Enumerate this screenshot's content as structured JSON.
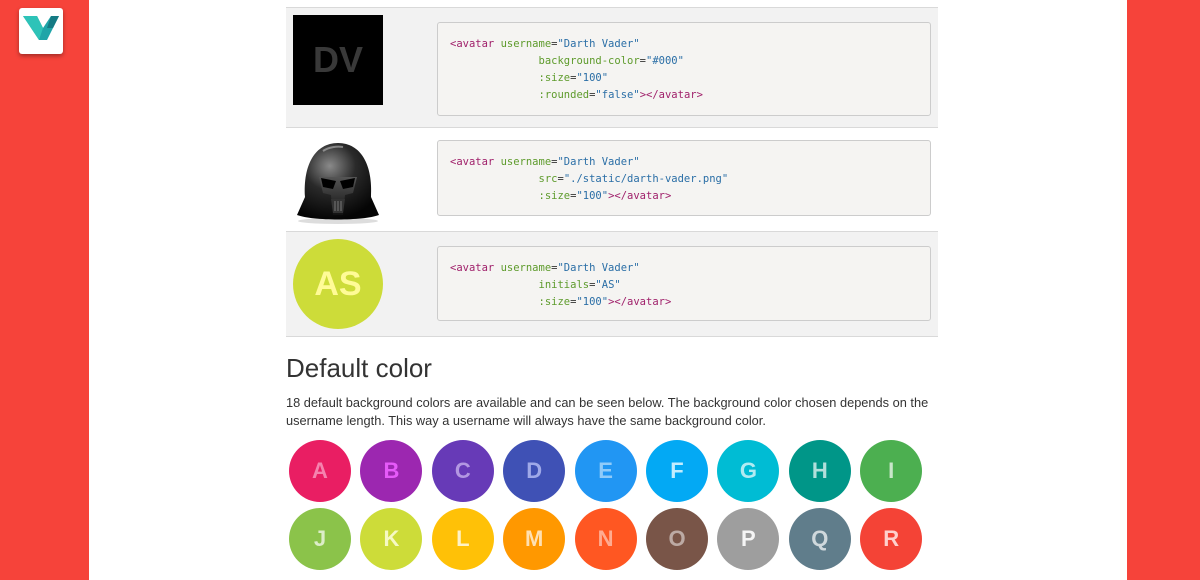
{
  "examples": [
    {
      "initials": "DV",
      "code": [
        [
          [
            "tag",
            "<avatar "
          ],
          [
            "attr",
            "username"
          ],
          [
            "pl",
            "="
          ],
          [
            "str",
            "\"Darth Vader\""
          ]
        ],
        [
          [
            "pl",
            "              "
          ],
          [
            "attr",
            "background-color"
          ],
          [
            "pl",
            "="
          ],
          [
            "str",
            "\"#000\""
          ]
        ],
        [
          [
            "pl",
            "              "
          ],
          [
            "attr",
            ":size"
          ],
          [
            "pl",
            "="
          ],
          [
            "str",
            "\"100\""
          ]
        ],
        [
          [
            "pl",
            "              "
          ],
          [
            "attr",
            ":rounded"
          ],
          [
            "pl",
            "="
          ],
          [
            "str",
            "\"false\""
          ],
          [
            "tag",
            "></avatar>"
          ]
        ]
      ]
    },
    {
      "image": "darth-vader-helmet",
      "code": [
        [
          [
            "tag",
            "<avatar "
          ],
          [
            "attr",
            "username"
          ],
          [
            "pl",
            "="
          ],
          [
            "str",
            "\"Darth Vader\""
          ]
        ],
        [
          [
            "pl",
            "              "
          ],
          [
            "attr",
            "src"
          ],
          [
            "pl",
            "="
          ],
          [
            "str",
            "\"./static/darth-vader.png\""
          ]
        ],
        [
          [
            "pl",
            "              "
          ],
          [
            "attr",
            ":size"
          ],
          [
            "pl",
            "="
          ],
          [
            "str",
            "\"100\""
          ],
          [
            "tag",
            "></avatar>"
          ]
        ]
      ]
    },
    {
      "initials": "AS",
      "code": [
        [
          [
            "tag",
            "<avatar "
          ],
          [
            "attr",
            "username"
          ],
          [
            "pl",
            "="
          ],
          [
            "str",
            "\"Darth Vader\""
          ]
        ],
        [
          [
            "pl",
            "              "
          ],
          [
            "attr",
            "initials"
          ],
          [
            "pl",
            "="
          ],
          [
            "str",
            "\"AS\""
          ]
        ],
        [
          [
            "pl",
            "              "
          ],
          [
            "attr",
            ":size"
          ],
          [
            "pl",
            "="
          ],
          [
            "str",
            "\"100\""
          ],
          [
            "tag",
            "></avatar>"
          ]
        ]
      ]
    }
  ],
  "default_color": {
    "title": "Default color",
    "description": "18 default background colors are available and can be seen below. The background color chosen depends on the username length. This way a username will always have the same background color.",
    "avatars": [
      {
        "letter": "A",
        "bg": "#e91e63",
        "fg": "#f582ae"
      },
      {
        "letter": "B",
        "bg": "#9c27b0",
        "fg": "#e65af9"
      },
      {
        "letter": "C",
        "bg": "#673ab7",
        "fg": "#b397e2"
      },
      {
        "letter": "D",
        "bg": "#3f51b5",
        "fg": "#9fa9e8"
      },
      {
        "letter": "E",
        "bg": "#2196f3",
        "fg": "#90cbf9"
      },
      {
        "letter": "F",
        "bg": "#03a9f4",
        "fg": "#c2ecfe"
      },
      {
        "letter": "G",
        "bg": "#00bcd4",
        "fg": "#b2ebf2"
      },
      {
        "letter": "H",
        "bg": "#009688",
        "fg": "#b2dfdb"
      },
      {
        "letter": "I",
        "bg": "#4caf50",
        "fg": "#c8e6c9"
      },
      {
        "letter": "J",
        "bg": "#8bc34a",
        "fg": "#dcedc8"
      },
      {
        "letter": "K",
        "bg": "#cddc39",
        "fg": "#f6f9c4"
      },
      {
        "letter": "L",
        "bg": "#ffc107",
        "fg": "#fff2c7"
      },
      {
        "letter": "M",
        "bg": "#ff9800",
        "fg": "#ffe0b2"
      },
      {
        "letter": "N",
        "bg": "#ff5722",
        "fg": "#ffab91"
      },
      {
        "letter": "O",
        "bg": "#795548",
        "fg": "#bcaaa4"
      },
      {
        "letter": "P",
        "bg": "#9e9e9e",
        "fg": "#f5f5f5"
      },
      {
        "letter": "Q",
        "bg": "#607d8b",
        "fg": "#cfd8dc"
      },
      {
        "letter": "R",
        "bg": "#f44336",
        "fg": "#fed0cc"
      }
    ]
  },
  "colors": {
    "frame": "#f6433a",
    "logo_teal": "#1fa5a8"
  }
}
